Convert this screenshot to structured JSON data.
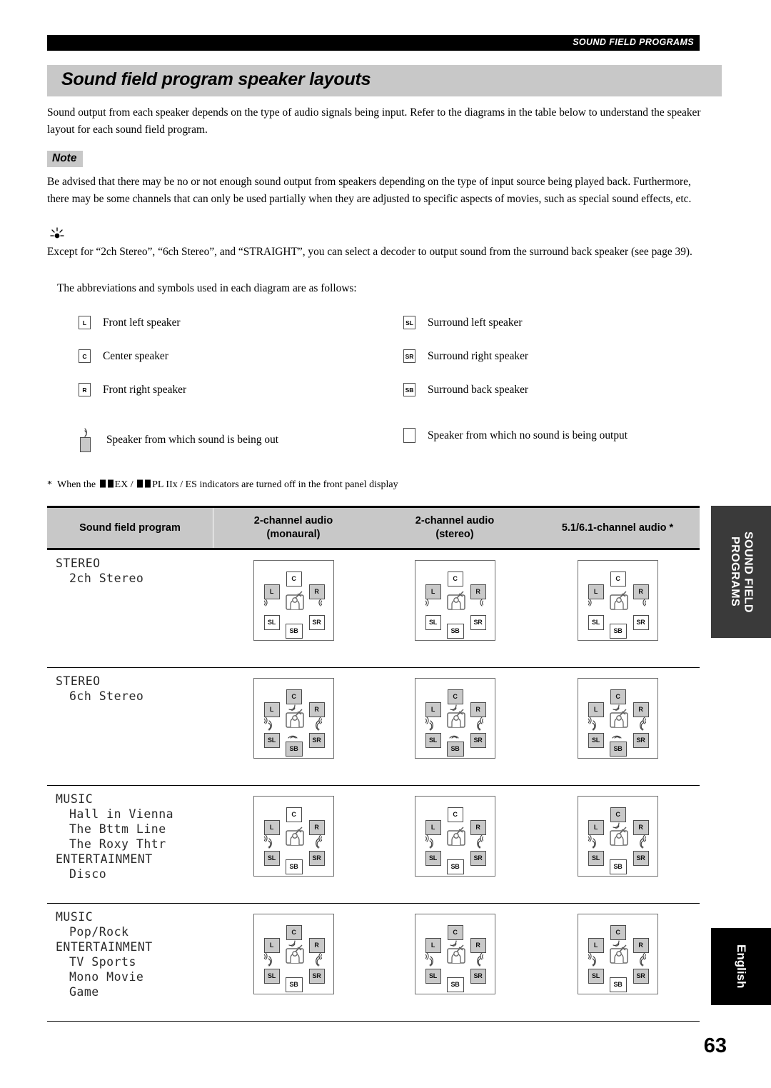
{
  "running_head": "SOUND FIELD PROGRAMS",
  "title": "Sound field program speaker layouts",
  "intro_paragraph": "Sound output from each speaker depends on the type of audio signals being input. Refer to the diagrams in the table below to understand the speaker layout for each sound field program.",
  "note": {
    "badge": "Note",
    "body": "Be advised that there may be no or not enough sound output from speakers depending on the type of input source being played back. Furthermore, there may be some channels that can only be used partially when they are adjusted to specific aspects of movies, such as special sound effects, etc."
  },
  "tip": {
    "icon": "tip-bulb-icon",
    "body": "Except for “2ch Stereo”, “6ch Stereo”, and “STRAIGHT”, you can select a decoder to output sound from the surround back speaker (see page 39)."
  },
  "abbrev_intro": "The abbreviations and symbols used in each diagram are as follows:",
  "legend": {
    "rows": [
      {
        "left": {
          "symbol": "L",
          "label": "Front left speaker"
        },
        "right": {
          "symbol": "SL",
          "label": "Surround left speaker"
        }
      },
      {
        "left": {
          "symbol": "C",
          "label": "Center speaker"
        },
        "right": {
          "symbol": "SR",
          "label": "Surround right speaker"
        }
      },
      {
        "left": {
          "symbol": "R",
          "label": "Front right speaker"
        },
        "right": {
          "symbol": "SB",
          "label": "Surround back speaker"
        }
      }
    ],
    "sound_on_label": "Speaker from which sound is being out",
    "sound_off_label": "Speaker from which no sound is being output"
  },
  "footnote": "*  When the ⒹⒹ EX / ⒹⒹ PL IIx / ES indicators are turned off in the front panel display",
  "footnote_parts": {
    "star": "*",
    "p1": "When the",
    "p2": "EX /",
    "p3": "PL IIx / ES indicators are turned off in the front panel display"
  },
  "table": {
    "headers": [
      "Sound field program",
      "2-channel audio\n(monaural)",
      "2-channel audio\n(stereo)",
      "5.1/6.1-channel audio *"
    ],
    "header_lines": [
      {
        "l1": "Sound field program",
        "l2": ""
      },
      {
        "l1": "2-channel audio",
        "l2": "(monaural)"
      },
      {
        "l1": "2-channel audio",
        "l2": "(stereo)"
      },
      {
        "l1": "5.1/6.1-channel audio *",
        "l2": ""
      }
    ],
    "rows": [
      {
        "programs": [
          {
            "text": "STEREO",
            "sub": false
          },
          {
            "text": "2ch Stereo",
            "sub": true
          }
        ],
        "diagrams": [
          {
            "L": true,
            "C": false,
            "R": true,
            "SL": false,
            "SB": false,
            "SR": false
          },
          {
            "L": true,
            "C": false,
            "R": true,
            "SL": false,
            "SB": false,
            "SR": false
          },
          {
            "L": true,
            "C": false,
            "R": true,
            "SL": false,
            "SB": false,
            "SR": false
          }
        ]
      },
      {
        "programs": [
          {
            "text": "STEREO",
            "sub": false
          },
          {
            "text": "6ch Stereo",
            "sub": true
          }
        ],
        "diagrams": [
          {
            "L": true,
            "C": true,
            "R": true,
            "SL": true,
            "SB": true,
            "SR": true
          },
          {
            "L": true,
            "C": true,
            "R": true,
            "SL": true,
            "SB": true,
            "SR": true
          },
          {
            "L": true,
            "C": true,
            "R": true,
            "SL": true,
            "SB": true,
            "SR": true
          }
        ]
      },
      {
        "programs": [
          {
            "text": "MUSIC",
            "sub": false
          },
          {
            "text": "Hall in Vienna",
            "sub": true
          },
          {
            "text": "The Bttm Line",
            "sub": true
          },
          {
            "text": "The Roxy Thtr",
            "sub": true
          },
          {
            "text": "ENTERTAINMENT",
            "sub": false
          },
          {
            "text": "Disco",
            "sub": true
          }
        ],
        "diagrams": [
          {
            "L": true,
            "C": false,
            "R": true,
            "SL": true,
            "SB": false,
            "SR": true
          },
          {
            "L": true,
            "C": false,
            "R": true,
            "SL": true,
            "SB": false,
            "SR": true
          },
          {
            "L": true,
            "C": true,
            "R": true,
            "SL": true,
            "SB": false,
            "SR": true
          }
        ]
      },
      {
        "programs": [
          {
            "text": "MUSIC",
            "sub": false
          },
          {
            "text": "Pop/Rock",
            "sub": true
          },
          {
            "text": "ENTERTAINMENT",
            "sub": false
          },
          {
            "text": "TV Sports",
            "sub": true
          },
          {
            "text": "Mono Movie",
            "sub": true
          },
          {
            "text": "Game",
            "sub": true
          }
        ],
        "diagrams": [
          {
            "L": true,
            "C": true,
            "R": true,
            "SL": true,
            "SB": false,
            "SR": true
          },
          {
            "L": true,
            "C": true,
            "R": true,
            "SL": true,
            "SB": false,
            "SR": true
          },
          {
            "L": true,
            "C": true,
            "R": true,
            "SL": true,
            "SB": false,
            "SR": true
          }
        ]
      }
    ]
  },
  "side_tabs": {
    "chapter": "SOUND FIELD\nPROGRAMS",
    "language": "English"
  },
  "page_number": "63",
  "colors": {
    "title_band": "#c8c8c8",
    "header_band": "#c8c8c8",
    "runhead": "#000000",
    "active_speaker": "#c9c9c9",
    "chapter_tab": "#3a3a3a",
    "language_tab": "#000000"
  }
}
